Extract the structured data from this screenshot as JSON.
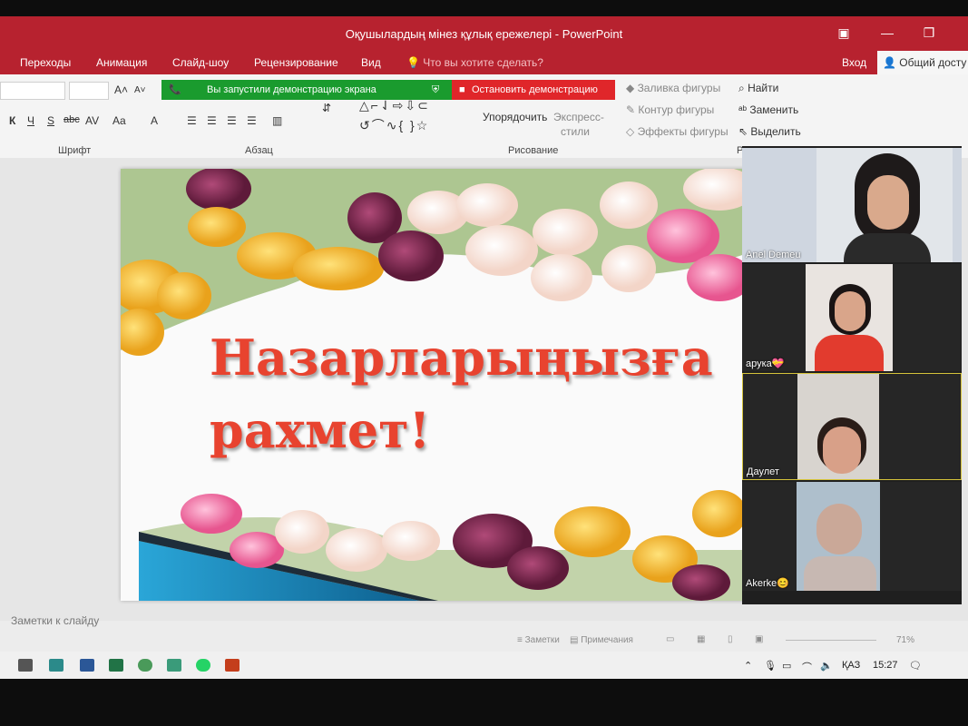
{
  "window": {
    "title": "Оқушылардың мінез құлық ережелері - PowerPoint",
    "user_login": "Вход",
    "share_label": "Общий досту"
  },
  "menu": {
    "items": [
      "Переходы",
      "Анимация",
      "Слайд-шоу",
      "Рецензирование",
      "Вид"
    ],
    "tell_me": "Что вы хотите сделать?"
  },
  "screenshare": {
    "status": "Вы запустили демонстрацию экрана",
    "stop_label": "Остановить демонстрацию"
  },
  "ribbon": {
    "groups": {
      "font": "Шрифт",
      "paragraph": "Абзац",
      "drawing": "Рисование",
      "editing": "Реда"
    },
    "arrange": "Упорядочить",
    "quick_styles_1": "Экспресс-",
    "quick_styles_2": "стили",
    "shape_fill": "Заливка фигуры",
    "shape_outline": "Контур фигуры",
    "shape_effects": "Эффекты фигуры",
    "find": "Найти",
    "replace": "Заменить",
    "select": "Выделить"
  },
  "slide": {
    "line1": "Назарларыңызға",
    "line2": "рахмет!"
  },
  "notes_placeholder": "Заметки к слайду",
  "statusbar": {
    "notes": "Заметки",
    "comments": "Примечания",
    "zoom": "71%"
  },
  "taskbar": {
    "language": "ҚАЗ",
    "time": "15:27"
  },
  "participants": [
    {
      "name": "Anel Demeu"
    },
    {
      "name": "арука💝"
    },
    {
      "name": "Даулет"
    },
    {
      "name": "Akerke😊"
    }
  ],
  "colors": {
    "title_bar": "#b7222f",
    "share_green": "#1a9b2e",
    "stop_red": "#e0262a",
    "slide_text": "#e8432f"
  }
}
